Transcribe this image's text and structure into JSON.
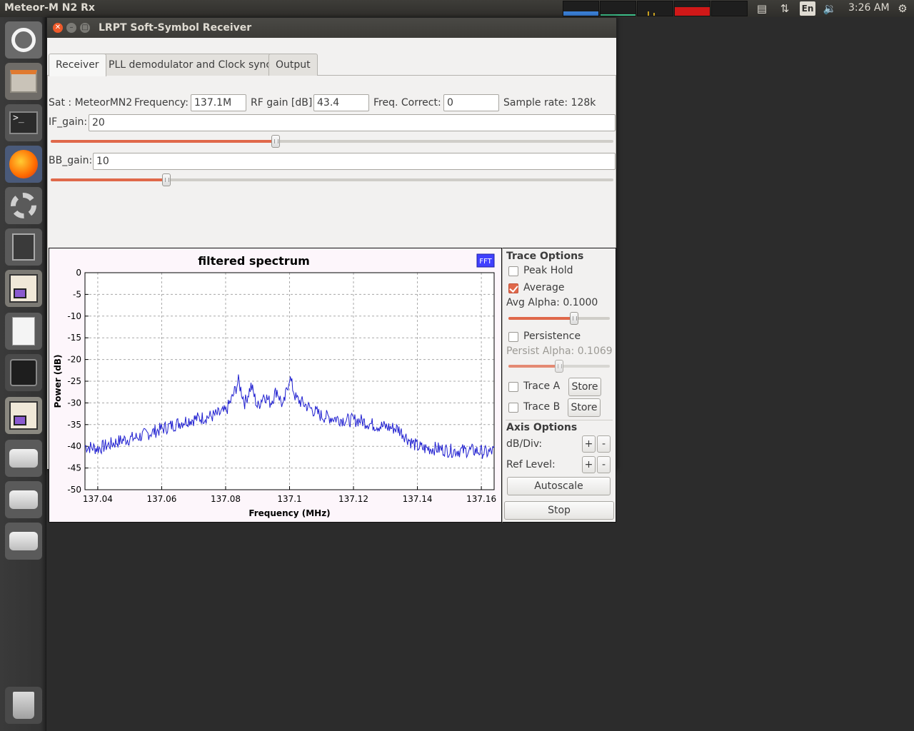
{
  "top_panel": {
    "app_title": "Meteor-M N2 Rx",
    "lang": "En",
    "clock": "3:26 AM"
  },
  "window": {
    "title": "LRPT Soft-Symbol Receiver",
    "tabs": [
      {
        "label": "Receiver"
      },
      {
        "label": "PLL demodulator and Clock sync"
      },
      {
        "label": "Output"
      }
    ]
  },
  "receiver": {
    "sat_label": "Sat : MeteorMN2",
    "frequency_label": "Frequency:",
    "frequency_value": "137.1M",
    "rf_gain_label": "RF gain [dB]:",
    "rf_gain_value": "43.4",
    "freq_correct_label": "Freq. Correct:",
    "freq_correct_value": "0",
    "sample_rate_label": "Sample rate: 128k",
    "if_gain_label": "IF_gain:",
    "if_gain_value": "20",
    "if_gain_level": 0.4,
    "bb_gain_label": "BB_gain:",
    "bb_gain_value": "10",
    "bb_gain_level": 0.205
  },
  "trace_options": {
    "title": "Trace Options",
    "peak_hold": "Peak Hold",
    "average": "Average",
    "avg_alpha": "Avg Alpha: 0.1000",
    "avg_alpha_level": 0.65,
    "persistence": "Persistence",
    "persist_alpha": "Persist Alpha: 0.1069",
    "persist_alpha_level": 0.5,
    "trace_a": "Trace A",
    "trace_b": "Trace B",
    "store": "Store",
    "axis_title": "Axis Options",
    "db_div": "dB/Div:",
    "ref_level": "Ref Level:",
    "plus": "+",
    "minus": "-",
    "autoscale": "Autoscale",
    "stop": "Stop"
  },
  "colors": {
    "accent": "#e0684a",
    "trace": "#2020d0",
    "fft_badge": "#4040ff"
  },
  "chart_data": {
    "type": "line",
    "title": "filtered spectrum",
    "badge": "FFT",
    "xlabel": "Frequency (MHz)",
    "ylabel": "Power (dB)",
    "xlim": [
      137.036,
      137.164
    ],
    "ylim": [
      -50,
      0
    ],
    "x_ticks": [
      {
        "v": 137.04,
        "label": "137.04"
      },
      {
        "v": 137.06,
        "label": "137.06"
      },
      {
        "v": 137.08,
        "label": "137.08"
      },
      {
        "v": 137.1,
        "label": "137.1"
      },
      {
        "v": 137.12,
        "label": "137.12"
      },
      {
        "v": 137.14,
        "label": "137.14"
      },
      {
        "v": 137.16,
        "label": "137.16"
      }
    ],
    "y_ticks": [
      0,
      -5,
      -10,
      -15,
      -20,
      -25,
      -30,
      -35,
      -40,
      -45,
      -50
    ],
    "grid": true,
    "series": [
      {
        "x": [
          137.036,
          137.04,
          137.044,
          137.048,
          137.052,
          137.056,
          137.06,
          137.064,
          137.068,
          137.072,
          137.076,
          137.08,
          137.082,
          137.084,
          137.086,
          137.088,
          137.09,
          137.092,
          137.094,
          137.096,
          137.098,
          137.1,
          137.102,
          137.104,
          137.106,
          137.108,
          137.11,
          137.114,
          137.118,
          137.122,
          137.126,
          137.13,
          137.134,
          137.138,
          137.14,
          137.142,
          137.146,
          137.15,
          137.154,
          137.158,
          137.162,
          137.164
        ],
        "y": [
          -40,
          -40.5,
          -39.5,
          -38.5,
          -38,
          -37,
          -36,
          -35,
          -34,
          -33.5,
          -33,
          -32,
          -29,
          -25,
          -30,
          -26,
          -31,
          -28,
          -30,
          -27,
          -31,
          -24,
          -29,
          -30,
          -31,
          -32,
          -33,
          -33.5,
          -34,
          -34,
          -35,
          -35.5,
          -36,
          -39,
          -40,
          -40.5,
          -40.5,
          -41,
          -41,
          -41,
          -41.5,
          -41
        ]
      }
    ]
  }
}
